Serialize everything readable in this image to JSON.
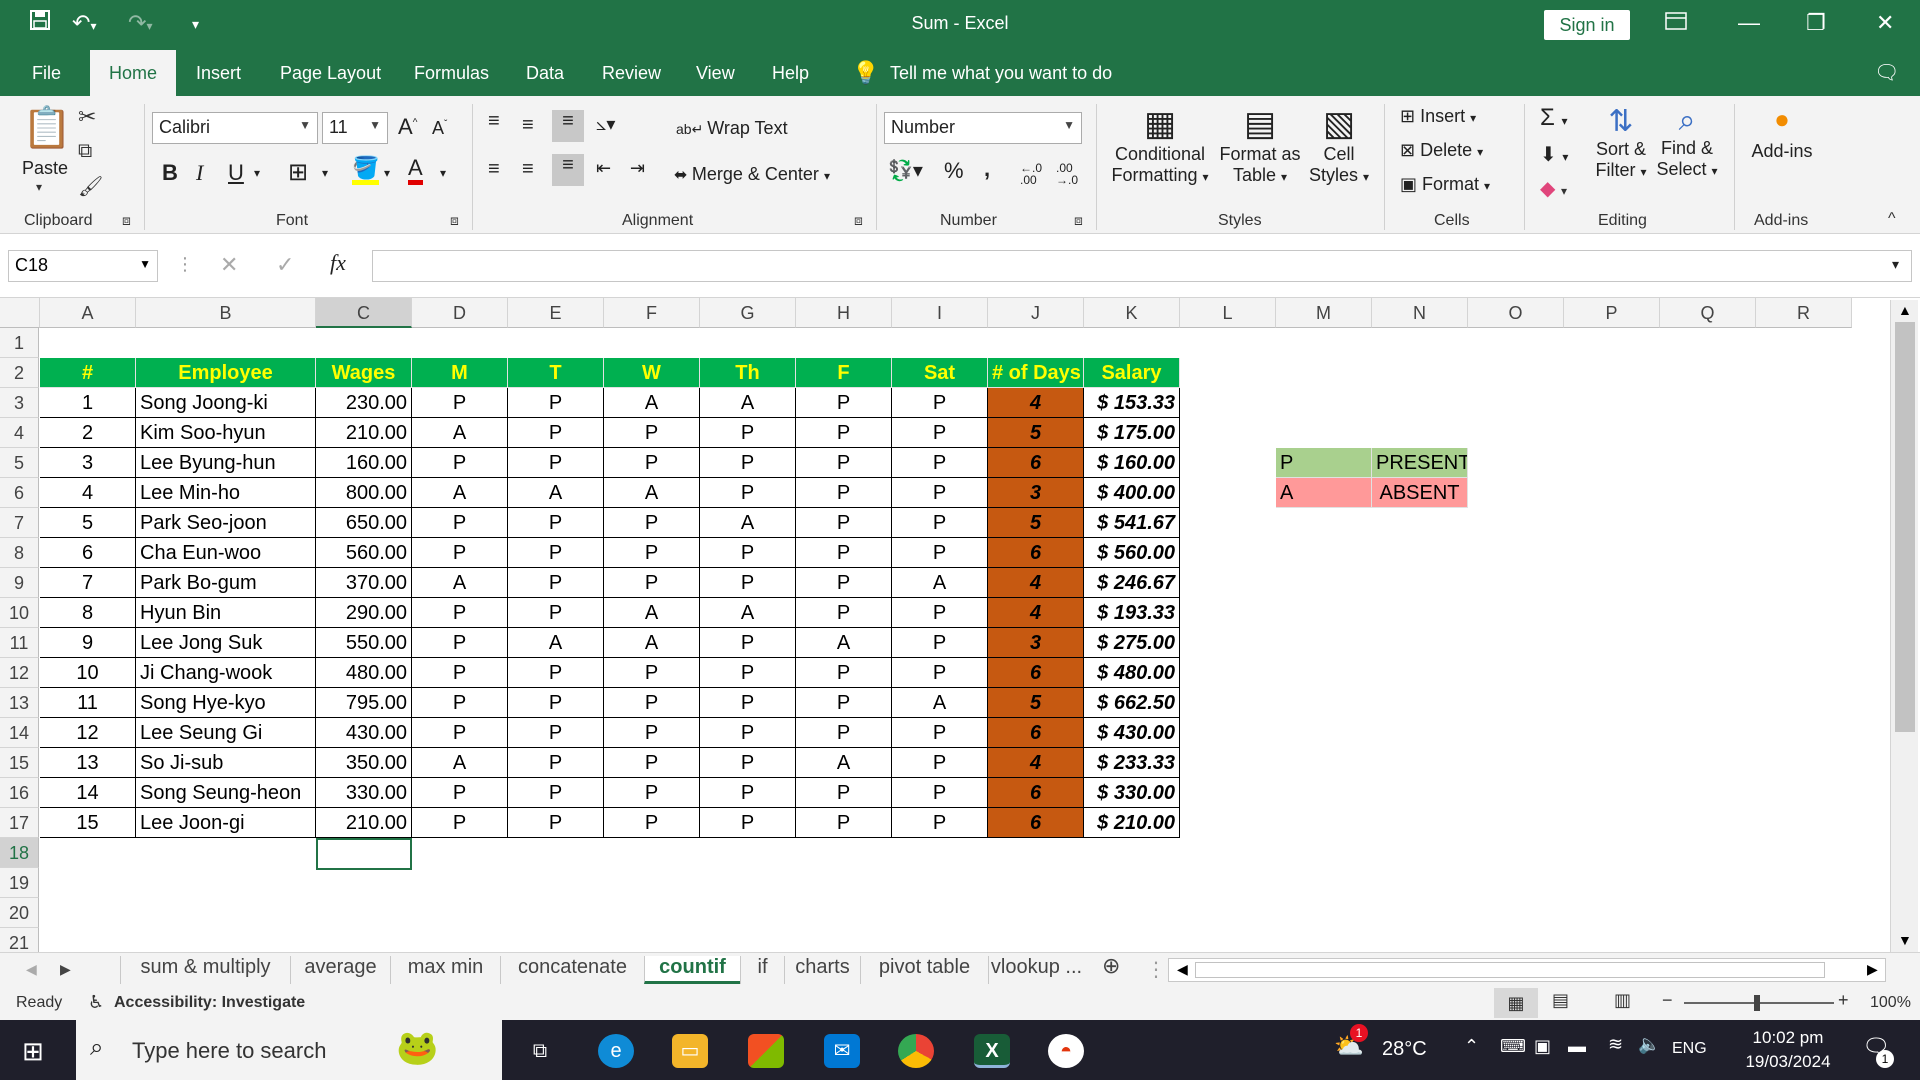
{
  "window": {
    "title": "Sum  -  Excel",
    "sign_in": "Sign in"
  },
  "menu": [
    "File",
    "Home",
    "Insert",
    "Page Layout",
    "Formulas",
    "Data",
    "Review",
    "View",
    "Help"
  ],
  "tell_me": "Tell me what you want to do",
  "ribbon": {
    "clipboard": {
      "paste": "Paste",
      "label": "Clipboard"
    },
    "font": {
      "name": "Calibri",
      "size": "11",
      "label": "Font"
    },
    "alignment": {
      "wrap": "Wrap Text",
      "merge": "Merge & Center",
      "label": "Alignment"
    },
    "number": {
      "format": "Number",
      "label": "Number"
    },
    "styles": {
      "cond1": "Conditional",
      "cond2": "Formatting",
      "fmt1": "Format as",
      "fmt2": "Table",
      "cell1": "Cell",
      "cell2": "Styles",
      "label": "Styles"
    },
    "cells": {
      "insert": "Insert",
      "delete": "Delete",
      "format": "Format",
      "label": "Cells"
    },
    "editing": {
      "sort1": "Sort &",
      "sort2": "Filter",
      "find1": "Find &",
      "find2": "Select",
      "label": "Editing"
    },
    "addins": {
      "button": "Add-ins",
      "label": "Add-ins"
    }
  },
  "namebox": "C18",
  "columns": [
    "A",
    "B",
    "C",
    "D",
    "E",
    "F",
    "G",
    "H",
    "I",
    "J",
    "K",
    "L",
    "M",
    "N",
    "O",
    "P",
    "Q",
    "R"
  ],
  "rows": [
    "1",
    "2",
    "3",
    "4",
    "5",
    "6",
    "7",
    "8",
    "9",
    "10",
    "11",
    "12",
    "13",
    "14",
    "15",
    "16",
    "17",
    "18",
    "19",
    "20",
    "21"
  ],
  "table": {
    "headers": [
      "#",
      "Employee",
      "Wages",
      "M",
      "T",
      "W",
      "Th",
      "F",
      "Sat",
      "# of Days",
      "Salary"
    ],
    "rows": [
      [
        "1",
        "Song Joong-ki",
        "230.00",
        "P",
        "P",
        "A",
        "A",
        "P",
        "P",
        "4",
        "$ 153.33"
      ],
      [
        "2",
        "Kim Soo-hyun",
        "210.00",
        "A",
        "P",
        "P",
        "P",
        "P",
        "P",
        "5",
        "$ 175.00"
      ],
      [
        "3",
        "Lee Byung-hun",
        "160.00",
        "P",
        "P",
        "P",
        "P",
        "P",
        "P",
        "6",
        "$ 160.00"
      ],
      [
        "4",
        "Lee Min-ho",
        "800.00",
        "A",
        "A",
        "A",
        "P",
        "P",
        "P",
        "3",
        "$ 400.00"
      ],
      [
        "5",
        "Park Seo-joon",
        "650.00",
        "P",
        "P",
        "P",
        "A",
        "P",
        "P",
        "5",
        "$ 541.67"
      ],
      [
        "6",
        "Cha Eun-woo",
        "560.00",
        "P",
        "P",
        "P",
        "P",
        "P",
        "P",
        "6",
        "$ 560.00"
      ],
      [
        "7",
        "Park Bo-gum",
        "370.00",
        "A",
        "P",
        "P",
        "P",
        "P",
        "A",
        "4",
        "$ 246.67"
      ],
      [
        "8",
        "Hyun Bin",
        "290.00",
        "P",
        "P",
        "A",
        "A",
        "P",
        "P",
        "4",
        "$ 193.33"
      ],
      [
        "9",
        "Lee Jong Suk",
        "550.00",
        "P",
        "A",
        "A",
        "P",
        "A",
        "P",
        "3",
        "$ 275.00"
      ],
      [
        "10",
        "Ji Chang-wook",
        "480.00",
        "P",
        "P",
        "P",
        "P",
        "P",
        "P",
        "6",
        "$ 480.00"
      ],
      [
        "11",
        "Song Hye-kyo",
        "795.00",
        "P",
        "P",
        "P",
        "P",
        "P",
        "A",
        "5",
        "$ 662.50"
      ],
      [
        "12",
        "Lee Seung Gi",
        "430.00",
        "P",
        "P",
        "P",
        "P",
        "P",
        "P",
        "6",
        "$ 430.00"
      ],
      [
        "13",
        "So Ji-sub",
        "350.00",
        "A",
        "P",
        "P",
        "P",
        "A",
        "P",
        "4",
        "$ 233.33"
      ],
      [
        "14",
        "Song Seung-heon",
        "330.00",
        "P",
        "P",
        "P",
        "P",
        "P",
        "P",
        "6",
        "$ 330.00"
      ],
      [
        "15",
        "Lee Joon-gi",
        "210.00",
        "P",
        "P",
        "P",
        "P",
        "P",
        "P",
        "6",
        "$ 210.00"
      ]
    ]
  },
  "legend": [
    {
      "code": "P",
      "meaning": "PRESENT",
      "color": "#a9d08e"
    },
    {
      "code": "A",
      "meaning": "ABSENT",
      "color": "#ff9999"
    }
  ],
  "colors": {
    "excel_green": "#217346",
    "header_fill": "#00b050",
    "header_text": "#ffff00",
    "days_fill": "#c65911"
  },
  "sheets": [
    "sum & multiply",
    "average",
    "max min",
    "concatenate",
    "countif",
    "if",
    "charts",
    "pivot table",
    "vlookup ..."
  ],
  "active_sheet": "countif",
  "status": {
    "ready": "Ready",
    "accessibility": "Accessibility: Investigate",
    "zoom": "100%"
  },
  "taskbar": {
    "search_placeholder": "Type here to search",
    "temp": "28°C",
    "lang": "ENG",
    "time": "10:02 pm",
    "date": "19/03/2024",
    "notif_count": "1",
    "weather_badge": "1"
  }
}
